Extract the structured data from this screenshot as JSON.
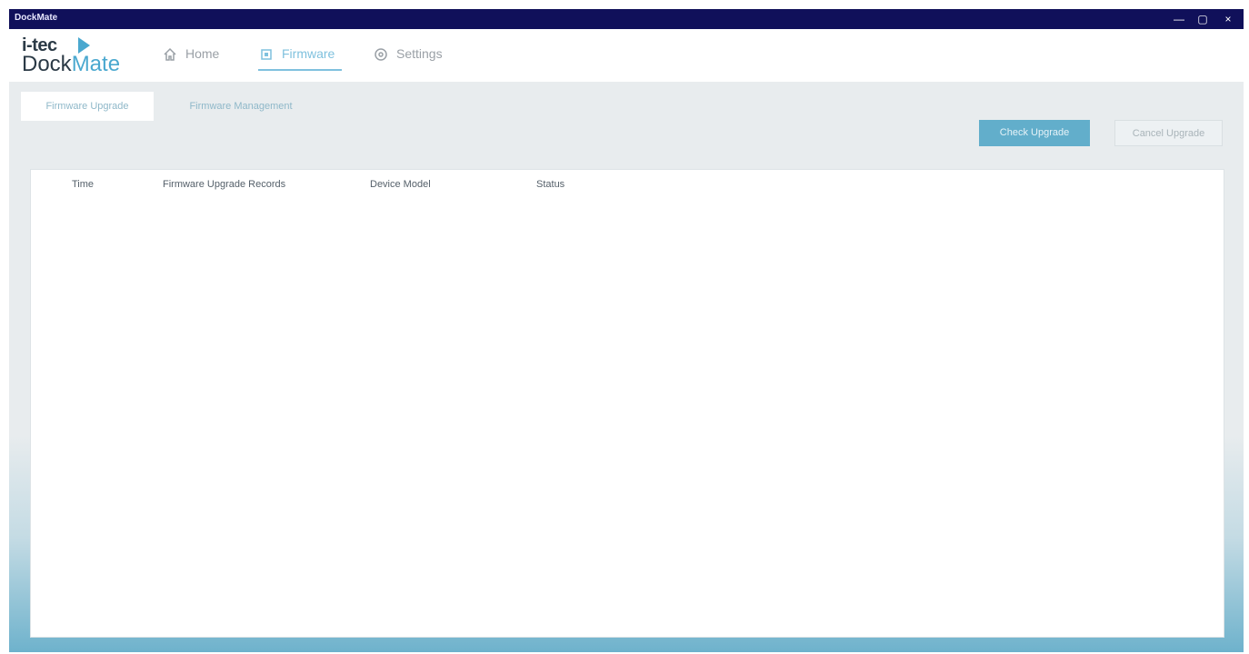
{
  "window": {
    "title": "DockMate",
    "controls": [
      "—",
      "▢",
      "×"
    ]
  },
  "logo": {
    "brand": "i-tec",
    "product_prefix": "Dock",
    "product_suffix": "Mate"
  },
  "nav": {
    "items": [
      {
        "label": "Home",
        "icon": "home-icon",
        "active": false
      },
      {
        "label": "Firmware",
        "icon": "firmware-icon",
        "active": true
      },
      {
        "label": "Settings",
        "icon": "gear-icon",
        "active": false
      }
    ]
  },
  "subtabs": [
    {
      "label": "Firmware Upgrade",
      "active": true
    },
    {
      "label": "Firmware Management",
      "active": false
    }
  ],
  "actions": {
    "primary_label": "Check Upgrade",
    "secondary_label": "Cancel Upgrade"
  },
  "table": {
    "columns": [
      "Time",
      "Firmware Upgrade Records",
      "Device Model",
      "Status"
    ],
    "rows": []
  },
  "colors": {
    "titlebar": "#10105a",
    "accent": "#62aecb",
    "active_nav": "#7fc1de"
  }
}
